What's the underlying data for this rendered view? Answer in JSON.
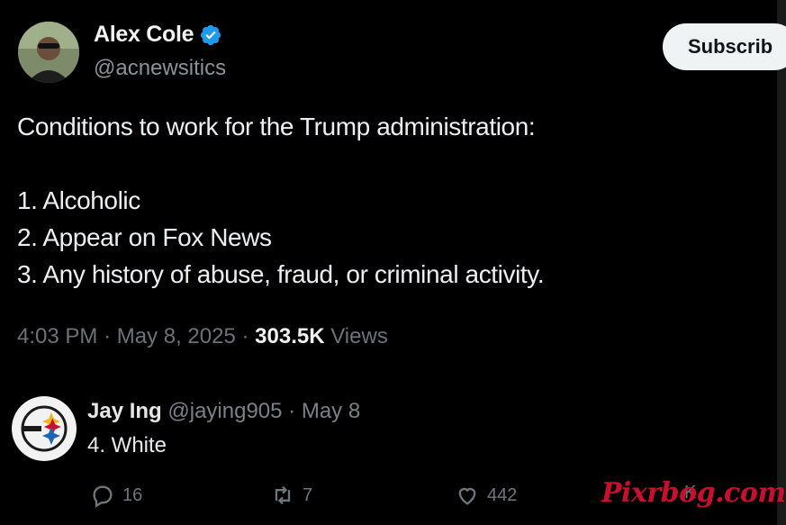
{
  "tweet": {
    "author": {
      "name": "Alex Cole",
      "handle": "@acnewsitics",
      "verified": true
    },
    "subscribe_label": "Subscrib",
    "body_lines": [
      "Conditions to work for the Trump administration:",
      "",
      "1.  Alcoholic",
      "2. Appear on Fox News",
      "3. Any history of abuse, fraud, or criminal activity."
    ],
    "meta": {
      "time": "4:03 PM",
      "separator": "·",
      "date": "May 8, 2025",
      "views_count": "303.5K",
      "views_label": "Views"
    }
  },
  "reply": {
    "name": "Jay Ing",
    "handle": "@jaying905",
    "separator": "·",
    "date": "May 8",
    "text": "4. White",
    "actions": {
      "replies": "16",
      "reposts": "7",
      "likes": "442",
      "views": "K"
    }
  },
  "colors": {
    "background": "#000000",
    "verified_badge": "#1d9bf0",
    "muted_text": "#6e767d",
    "watermark": "#c8102e"
  },
  "icons": [
    "verified-badge-icon",
    "reply-icon",
    "repost-icon",
    "like-icon",
    "steelers-logo-icon"
  ],
  "watermark": "Pixrbog.com"
}
